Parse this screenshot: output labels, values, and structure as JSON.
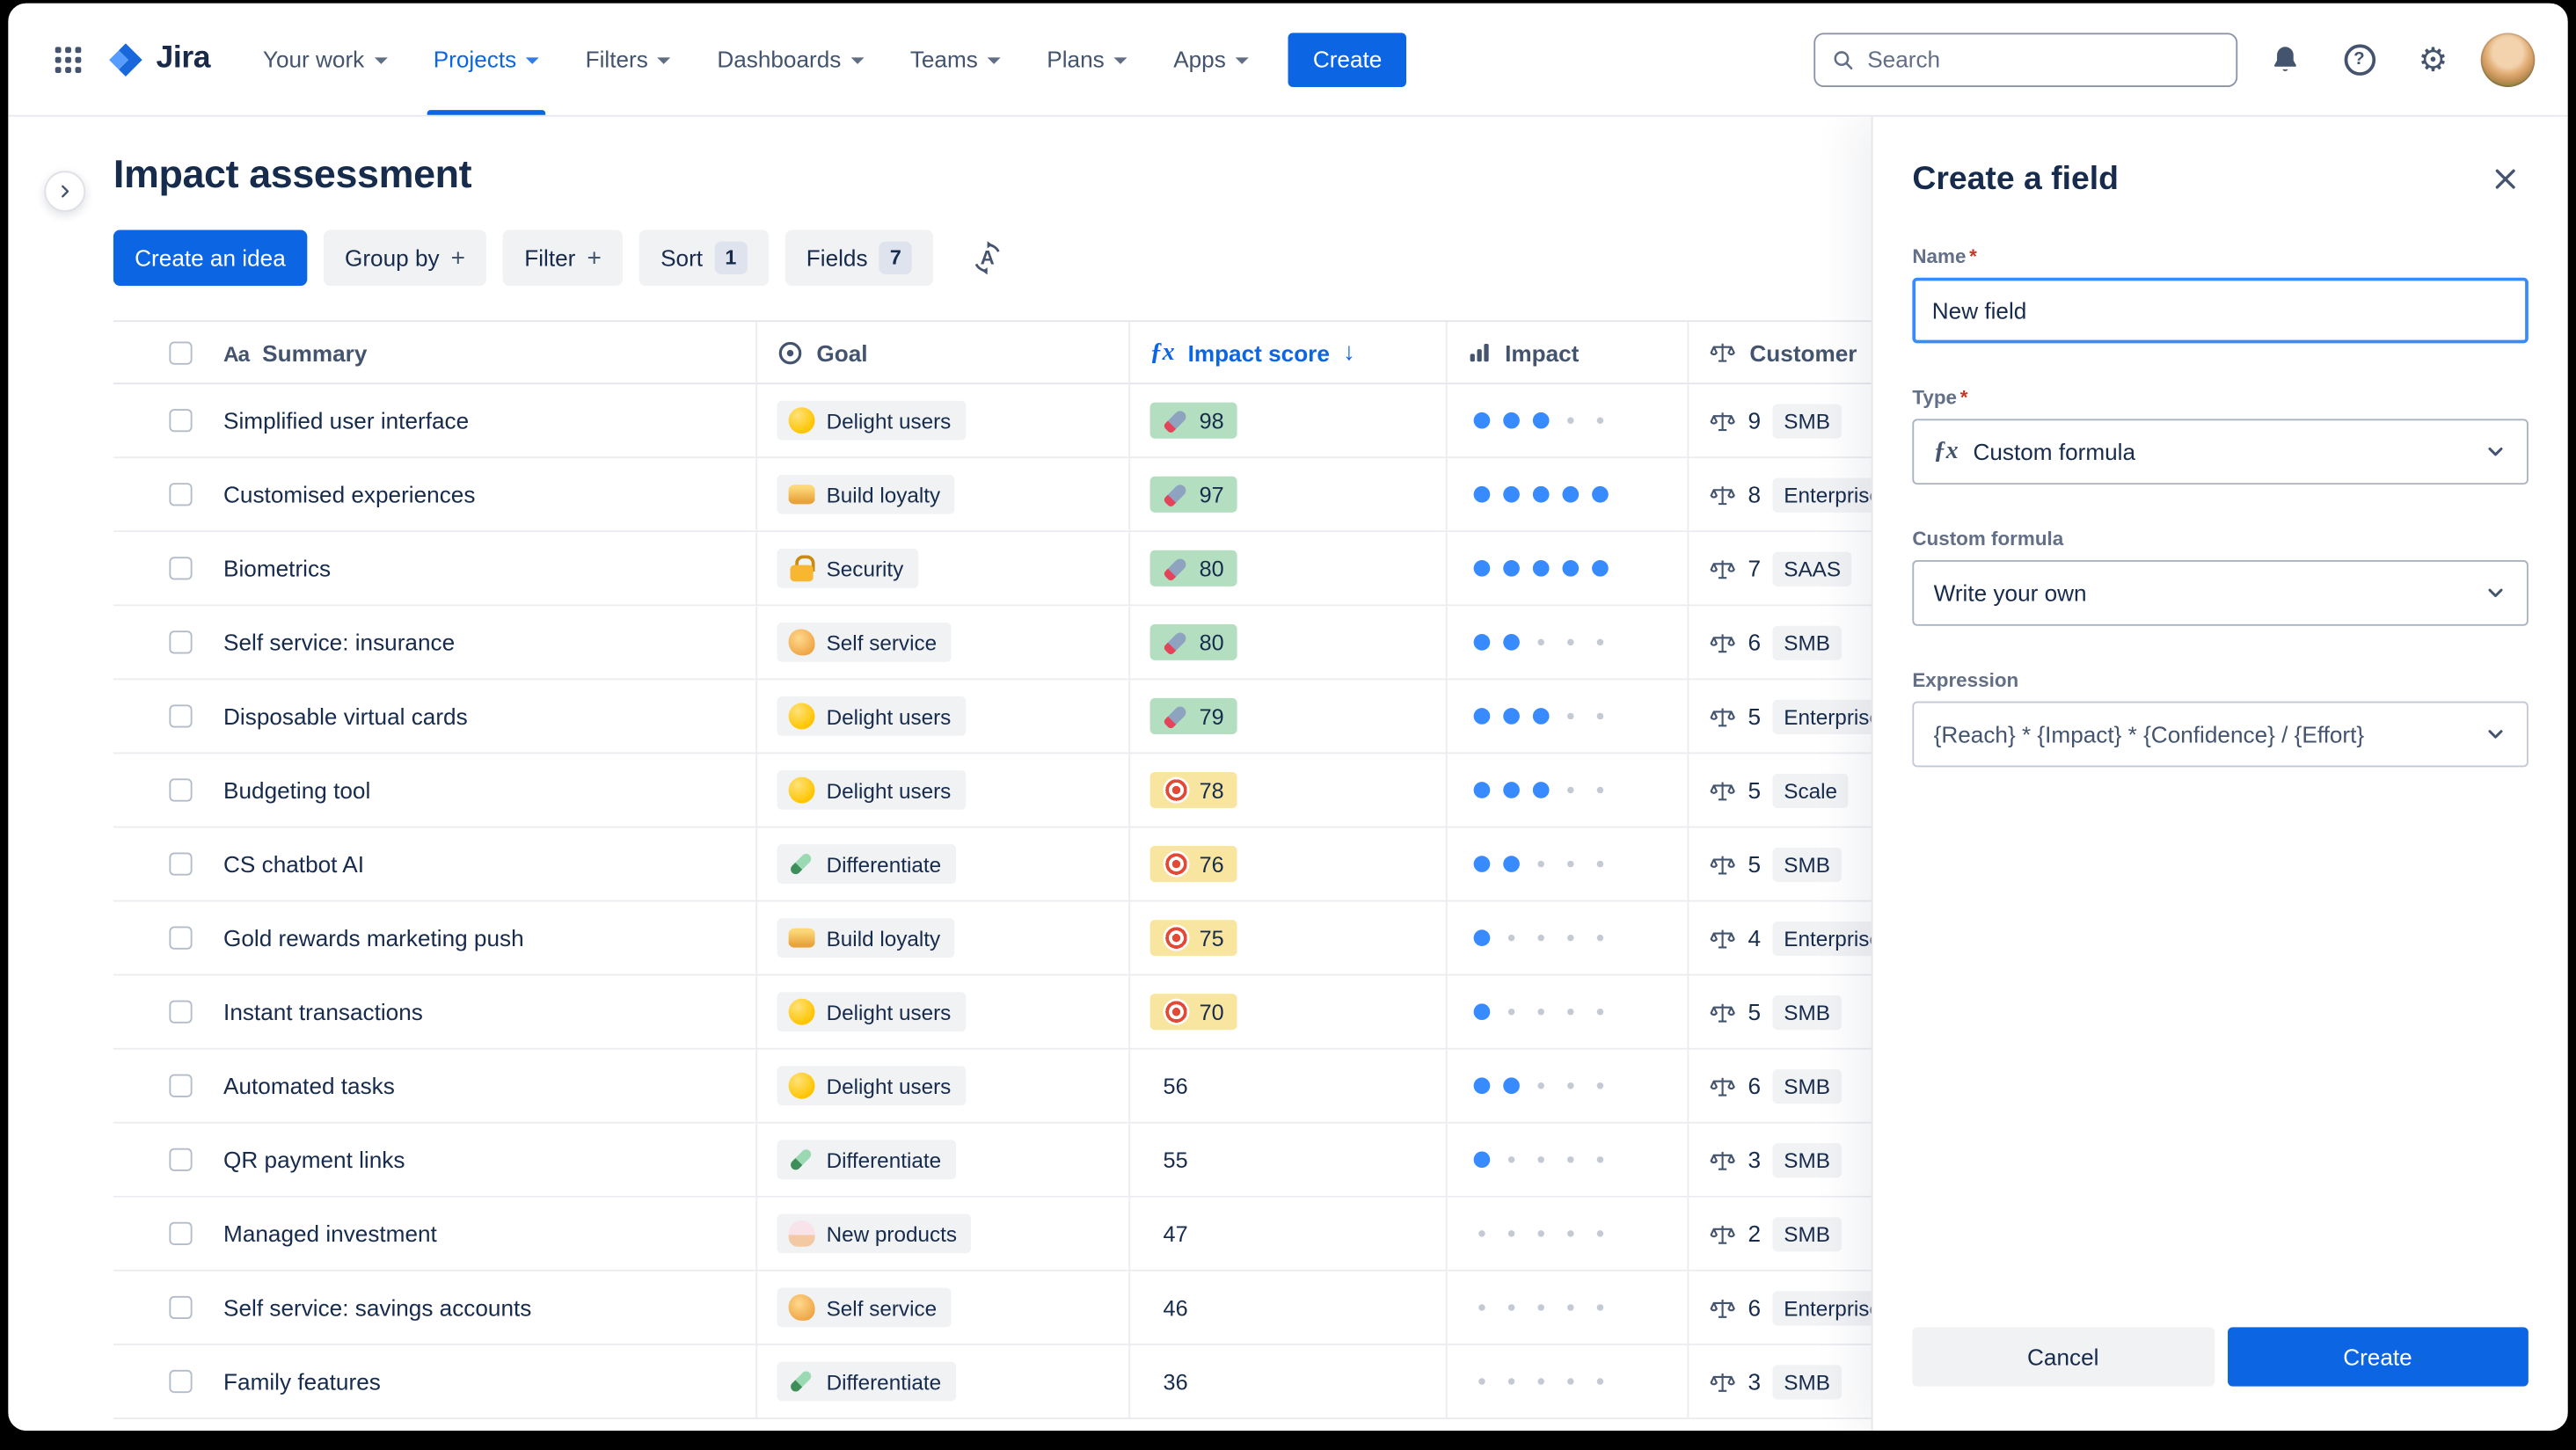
{
  "colors": {
    "accent_blue": "#0C66E4",
    "score_green_bg": "#B3DFC0",
    "score_yellow_bg": "#F8E6A0",
    "impact_dot_blue": "#388BFF",
    "text_primary": "#172B4D",
    "text_secondary": "#44546F"
  },
  "nav": {
    "logo_text": "Jira",
    "items": [
      {
        "label": "Your work",
        "active": false
      },
      {
        "label": "Projects",
        "active": true
      },
      {
        "label": "Filters",
        "active": false
      },
      {
        "label": "Dashboards",
        "active": false
      },
      {
        "label": "Teams",
        "active": false
      },
      {
        "label": "Plans",
        "active": false
      },
      {
        "label": "Apps",
        "active": false
      }
    ],
    "create_label": "Create",
    "search_placeholder": "Search"
  },
  "page": {
    "title": "Impact assessment"
  },
  "toolbar": {
    "create_idea_label": "Create an idea",
    "group_by_label": "Group by",
    "filter_label": "Filter",
    "sort_label": "Sort",
    "sort_count": "1",
    "fields_label": "Fields",
    "fields_count": "7"
  },
  "table": {
    "impact_dots_max": 5,
    "columns": [
      {
        "label": "Summary",
        "icon": "aa-icon"
      },
      {
        "label": "Goal",
        "icon": "goal-circle-icon"
      },
      {
        "label": "Impact score",
        "icon": "formula-fx-icon",
        "sort": "desc"
      },
      {
        "label": "Impact",
        "icon": "bar-chart-icon"
      },
      {
        "label": "Customer",
        "icon": "scale-icon"
      }
    ],
    "rows": [
      {
        "summary": "Simplified user interface",
        "goal": {
          "icon": "heart-eyes-emoji",
          "label": "Delight users"
        },
        "score": {
          "value": "98",
          "icon": "rocket-emoji",
          "tone": "green"
        },
        "impact_dots": 3,
        "customer": {
          "count": "9",
          "tag": "SMB"
        }
      },
      {
        "summary": "Customised experiences",
        "goal": {
          "icon": "handshake-emoji",
          "label": "Build loyalty"
        },
        "score": {
          "value": "97",
          "icon": "rocket-emoji",
          "tone": "green"
        },
        "impact_dots": 5,
        "customer": {
          "count": "8",
          "tag": "Enterprise"
        }
      },
      {
        "summary": "Biometrics",
        "goal": {
          "icon": "lock-emoji",
          "label": "Security"
        },
        "score": {
          "value": "80",
          "icon": "rocket-emoji",
          "tone": "green"
        },
        "impact_dots": 5,
        "customer": {
          "count": "7",
          "tag": "SAAS"
        }
      },
      {
        "summary": "Self service: insurance",
        "goal": {
          "icon": "flex-emoji",
          "label": "Self service"
        },
        "score": {
          "value": "80",
          "icon": "rocket-emoji",
          "tone": "green"
        },
        "impact_dots": 2,
        "customer": {
          "count": "6",
          "tag": "SMB"
        }
      },
      {
        "summary": "Disposable virtual cards",
        "goal": {
          "icon": "heart-eyes-emoji",
          "label": "Delight users"
        },
        "score": {
          "value": "79",
          "icon": "rocket-emoji",
          "tone": "green"
        },
        "impact_dots": 3,
        "customer": {
          "count": "5",
          "tag": "Enterprise"
        }
      },
      {
        "summary": "Budgeting tool",
        "goal": {
          "icon": "heart-eyes-emoji",
          "label": "Delight users"
        },
        "score": {
          "value": "78",
          "icon": "target-emoji",
          "tone": "yellow"
        },
        "impact_dots": 3,
        "customer": {
          "count": "5",
          "tag": "Scale"
        }
      },
      {
        "summary": "CS chatbot AI",
        "goal": {
          "icon": "paintbrush-emoji",
          "label": "Differentiate"
        },
        "score": {
          "value": "76",
          "icon": "target-emoji",
          "tone": "yellow"
        },
        "impact_dots": 2,
        "customer": {
          "count": "5",
          "tag": "SMB"
        }
      },
      {
        "summary": "Gold rewards marketing push",
        "goal": {
          "icon": "handshake-emoji",
          "label": "Build loyalty"
        },
        "score": {
          "value": "75",
          "icon": "target-emoji",
          "tone": "yellow"
        },
        "impact_dots": 1,
        "customer": {
          "count": "4",
          "tag": "Enterprise"
        }
      },
      {
        "summary": "Instant transactions",
        "goal": {
          "icon": "heart-eyes-emoji",
          "label": "Delight users"
        },
        "score": {
          "value": "70",
          "icon": "target-emoji",
          "tone": "yellow"
        },
        "impact_dots": 1,
        "customer": {
          "count": "5",
          "tag": "SMB"
        }
      },
      {
        "summary": "Automated tasks",
        "goal": {
          "icon": "heart-eyes-emoji",
          "label": "Delight users"
        },
        "score": {
          "value": "56",
          "icon": null,
          "tone": null
        },
        "impact_dots": 2,
        "customer": {
          "count": "6",
          "tag": "SMB"
        }
      },
      {
        "summary": "QR payment links",
        "goal": {
          "icon": "paintbrush-emoji",
          "label": "Differentiate"
        },
        "score": {
          "value": "55",
          "icon": null,
          "tone": null
        },
        "impact_dots": 1,
        "customer": {
          "count": "3",
          "tag": "SMB"
        }
      },
      {
        "summary": "Managed investment",
        "goal": {
          "icon": "ice-cream-emoji",
          "label": "New products"
        },
        "score": {
          "value": "47",
          "icon": null,
          "tone": null
        },
        "impact_dots": 0,
        "customer": {
          "count": "2",
          "tag": "SMB"
        }
      },
      {
        "summary": "Self service: savings accounts",
        "goal": {
          "icon": "flex-emoji",
          "label": "Self service"
        },
        "score": {
          "value": "46",
          "icon": null,
          "tone": null
        },
        "impact_dots": 0,
        "customer": {
          "count": "6",
          "tag": "Enterprise"
        }
      },
      {
        "summary": "Family features",
        "goal": {
          "icon": "paintbrush-emoji",
          "label": "Differentiate"
        },
        "score": {
          "value": "36",
          "icon": null,
          "tone": null
        },
        "impact_dots": 0,
        "customer": {
          "count": "3",
          "tag": "SMB"
        }
      }
    ]
  },
  "panel": {
    "title": "Create a field",
    "name": {
      "label": "Name",
      "value": "New field"
    },
    "type": {
      "label": "Type",
      "value": "Custom formula"
    },
    "custom_formula": {
      "label": "Custom formula",
      "value": "Write your own"
    },
    "expression": {
      "label": "Expression",
      "value": "{Reach} * {Impact} * {Confidence} / {Effort}"
    },
    "cancel_label": "Cancel",
    "create_label": "Create"
  }
}
